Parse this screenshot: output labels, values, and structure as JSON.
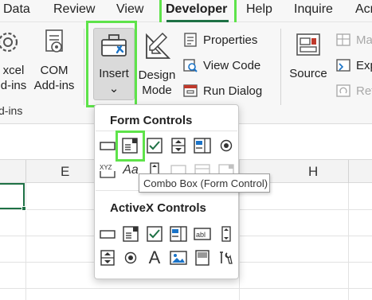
{
  "tabs": [
    {
      "label": "Data"
    },
    {
      "label": "Review"
    },
    {
      "label": "View"
    },
    {
      "label": "Developer"
    },
    {
      "label": "Help"
    },
    {
      "label": "Inquire"
    },
    {
      "label": "Acr"
    }
  ],
  "ribbon": {
    "addins": {
      "excel_label_1": "xcel",
      "excel_label_2": "d-ins",
      "com_label_1": "COM",
      "com_label_2": "Add-ins",
      "group_label": "d-ins"
    },
    "controls": {
      "insert_label": "Insert",
      "insert_chevron": "⌄",
      "design_label_1": "Design",
      "design_label_2": "Mode",
      "properties_label": "Properties",
      "view_code_label": "View Code",
      "run_dialog_label": "Run Dialog"
    },
    "xml": {
      "source_label": "Source",
      "map_label": "Ma",
      "exp_label": "Exp",
      "ref_label": "Ref"
    }
  },
  "sheet": {
    "columns": [
      "E",
      "H"
    ]
  },
  "dropdown": {
    "form_controls_title": "Form Controls",
    "activex_controls_title": "ActiveX Controls",
    "label_control_text": "Aa",
    "activex_label_text": "A",
    "tooltip": "Combo Box (Form Control)"
  },
  "colors": {
    "highlight": "#5ee34a",
    "excel_green": "#1e7145"
  }
}
